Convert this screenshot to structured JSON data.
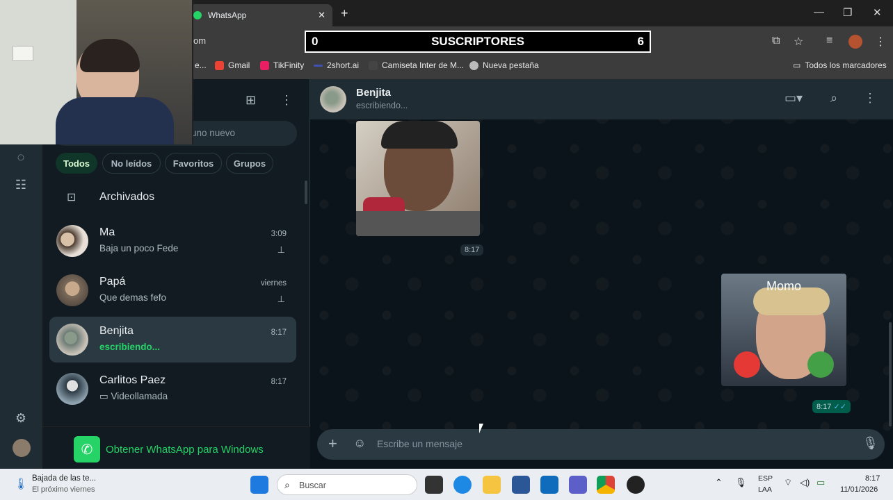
{
  "browser": {
    "tab_title": "WhatsApp",
    "url_fragment": "om",
    "overlay": {
      "left": "0",
      "label": "SUSCRIPTORES",
      "right": "6"
    },
    "bookmarks": [
      {
        "label": "Gmail",
        "icon": "gmail-icon",
        "color": "#ea4335"
      },
      {
        "label": "TikFinity",
        "icon": "tikfinity-icon",
        "color": "#e91e63"
      },
      {
        "label": "2short.ai",
        "icon": "2short-icon",
        "color": "#3f51b5"
      },
      {
        "label": "Camiseta Inter de M...",
        "icon": "bookmark-page-icon",
        "color": "#444444"
      },
      {
        "label": "Nueva pestaña",
        "icon": "globe-icon",
        "color": "#bbbbbb"
      }
    ],
    "bookmarks_folder": "Todos los marcadores",
    "bookmark_truncated": "e..."
  },
  "sidebar": {
    "search_placeholder_fragment": "uno nuevo",
    "filters": [
      "Todos",
      "No leídos",
      "Favoritos",
      "Grupos"
    ],
    "archived": "Archivados",
    "chats": [
      {
        "name": "Ma",
        "preview": "Baja un poco Fede",
        "time": "3:09",
        "pinned": true
      },
      {
        "name": "Papá",
        "preview": "Que demas fefo",
        "time": "viernes",
        "pinned": true
      },
      {
        "name": "Benjita",
        "preview": "escribiendo...",
        "time": "8:17",
        "typing": true
      },
      {
        "name": "Carlitos Paez",
        "preview": "Videollamada",
        "time": "8:17"
      }
    ],
    "get_app": "Obtener WhatsApp para Windows"
  },
  "chat": {
    "contact": "Benjita",
    "status": "escribiendo...",
    "messages": [
      {
        "side": "in",
        "type": "image",
        "time": "8:17"
      },
      {
        "side": "out",
        "type": "image",
        "caption_on_image": "Momo",
        "time": "8:17",
        "read": true
      }
    ],
    "input_placeholder": "Escribe un mensaje"
  },
  "taskbar": {
    "weather_title": "Bajada de las te...",
    "weather_sub": "El próximo viernes",
    "search": "Buscar",
    "lang": "ESP",
    "lang_sub": "LAA",
    "time": "8:17",
    "date": "11/01/2026"
  },
  "colors": {
    "accent": "#25d366",
    "panel": "#111b21",
    "header": "#202c33",
    "chat_bg": "#0b141a"
  }
}
